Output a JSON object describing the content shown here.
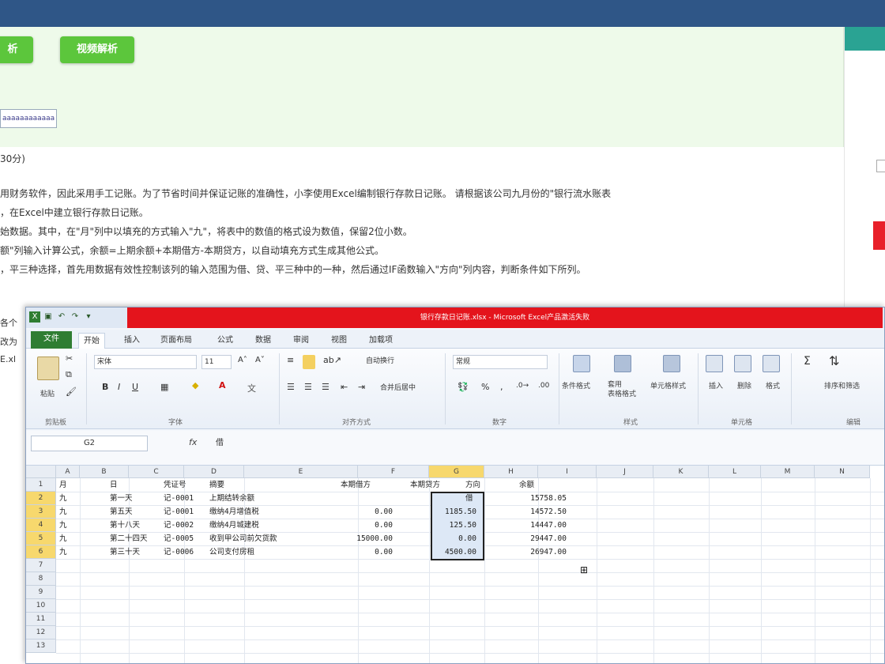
{
  "exam": {
    "buttons": [
      "析",
      "视频解析"
    ],
    "field_value": "aaaaaaaaaaaa",
    "score": "30分)",
    "lines": [
      "用财务软件，因此采用手工记账。为了节省时间并保证记账的准确性，小李使用Excel编制银行存款日记账。 请根据该公司九月份的\"银行流水账表",
      "，在Excel中建立银行存款日记账。",
      "始数据。其中，在\"月\"列中以填充的方式输入\"九\"，将表中的数值的格式设为数值，保留2位小数。",
      "额\"列输入计算公式，余额=上期余额+本期借方-本期贷方，以自动填充方式生成其他公式。",
      "，平三种选择，首先用数据有效性控制该列的输入范围为借、贷、平三种中的一种，然后通过IF函数输入\"方向\"列内容，判断条件如下所列。"
    ],
    "left_fragments": [
      "各个",
      "改为",
      "E.xl"
    ]
  },
  "excel": {
    "title": "银行存款日记账.xlsx - Microsoft Excel产品激活失败",
    "tabs": [
      "文件",
      "开始",
      "插入",
      "页面布局",
      "公式",
      "数据",
      "审阅",
      "视图",
      "加载项"
    ],
    "ribbon": {
      "paste": "粘贴",
      "font_name": "宋体",
      "font_size": "11",
      "wrap": "自动换行",
      "number_format": "常规",
      "merge": "合并后居中",
      "groups": [
        "剪贴板",
        "字体",
        "对齐方式",
        "数字",
        "样式",
        "单元格",
        "编辑"
      ],
      "styles": [
        "条件格式",
        "套用\n表格格式",
        "单元格样式"
      ],
      "cells": [
        "插入",
        "删除",
        "格式"
      ],
      "edit": [
        "排序和筛选"
      ]
    },
    "namebox": "G2",
    "fx": "fx",
    "formula": "借",
    "columns": [
      "A",
      "B",
      "C",
      "D",
      "E",
      "F",
      "G",
      "H",
      "I",
      "J",
      "K",
      "L",
      "M",
      "N"
    ],
    "rows": [
      "1",
      "2",
      "3",
      "4",
      "5",
      "6",
      "7",
      "8",
      "9",
      "10",
      "11",
      "12",
      "13"
    ],
    "headers": [
      "月",
      "日",
      "凭证号",
      "摘要",
      "本期借方",
      "本期贷方",
      "方向",
      "余额"
    ],
    "data": [
      [
        "九",
        "第一天",
        "记-0001",
        "上期结转余额",
        "",
        "",
        "借",
        "15758.05"
      ],
      [
        "九",
        "第五天",
        "记-0001",
        "缴纳4月增值税",
        "0.00",
        "1185.50",
        "",
        "14572.50"
      ],
      [
        "九",
        "第十八天",
        "记-0002",
        "缴纳4月城建税",
        "0.00",
        "125.50",
        "",
        "14447.00"
      ],
      [
        "九",
        "第二十四天",
        "记-0005",
        "收到甲公司前欠货款",
        "15000.00",
        "0.00",
        "",
        "29447.00"
      ],
      [
        "九",
        "第三十天",
        "记-0006",
        "公司支付房租",
        "0.00",
        "4500.00",
        "",
        "26947.00"
      ]
    ]
  }
}
